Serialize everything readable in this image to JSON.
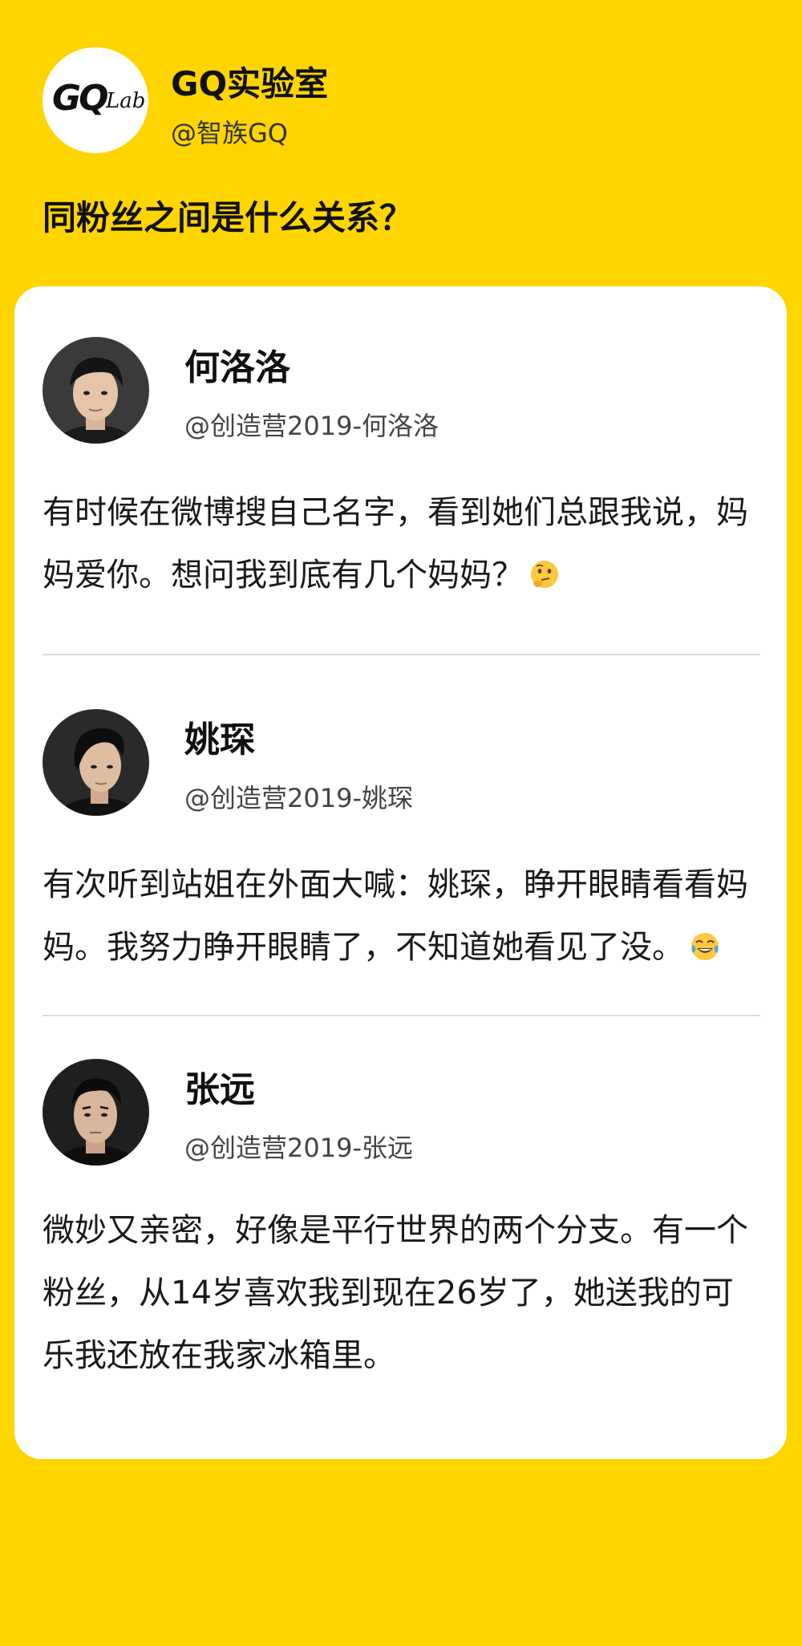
{
  "header": {
    "logo_text_main": "GQ",
    "logo_text_sub": "Lab",
    "account_name": "GQ实验室",
    "account_handle": "@智族GQ"
  },
  "question": "同粉丝之间是什么关系？",
  "entries": [
    {
      "name": "何洛洛",
      "handle": "@创造营2019-何洛洛",
      "quote": "有时候在微博搜自己名字，看到她们总跟我说，妈妈爱你。想问我到底有几个妈妈？",
      "emoji": "thinking-face-emoji"
    },
    {
      "name": "姚琛",
      "handle": "@创造营2019-姚琛",
      "quote": "有次听到站姐在外面大喊：姚琛，睁开眼睛看看妈妈。我努力睁开眼睛了，不知道她看见了没。",
      "emoji": "tears-of-joy-emoji"
    },
    {
      "name": "张远",
      "handle": "@创造营2019-张远",
      "quote": "微妙又亲密，好像是平行世界的两个分支。有一个粉丝，从14岁喜欢我到现在26岁了，她送我的可乐我还放在我家冰箱里。"
    }
  ],
  "colors": {
    "background": "#FFD500",
    "card": "#FFFFFF",
    "text": "#111111"
  }
}
